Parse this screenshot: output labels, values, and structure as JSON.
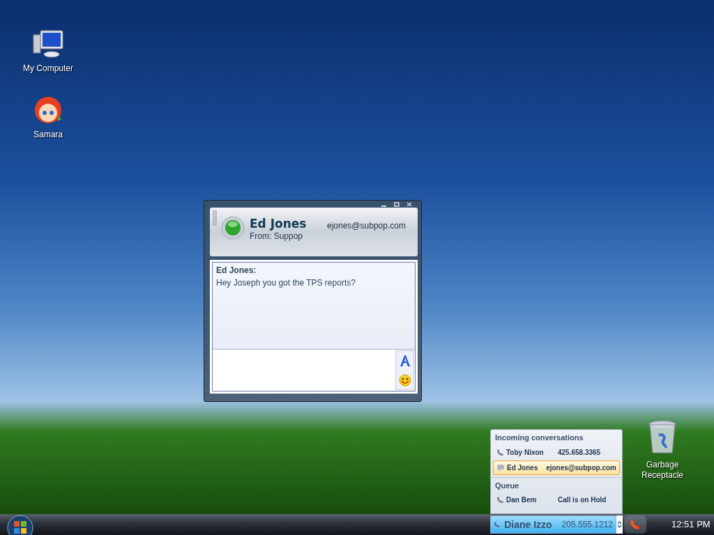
{
  "desktop_icons": [
    {
      "label": "My Computer",
      "kind": "computer"
    },
    {
      "label": "Samara",
      "kind": "avatar"
    },
    {
      "label": "Garbage Receptacle",
      "kind": "trash"
    }
  ],
  "chat_window": {
    "contact_name": "Ed Jones",
    "contact_email": "ejones@subpop.com",
    "from": "From: Suppop",
    "messages": [
      {
        "sender": "Ed Jones:",
        "text": "Hey Joseph you got the TPS reports?"
      }
    ]
  },
  "conversations_panel": {
    "sections": [
      {
        "title": "Incoming conversations",
        "items": [
          {
            "name": "Toby Nixon",
            "detail": "425.658.3365",
            "kind": "phone",
            "selected": false
          },
          {
            "name": "Ed Jones",
            "detail": "ejones@subpop.com",
            "kind": "chat",
            "selected": true
          }
        ]
      },
      {
        "title": "Queue",
        "items": [
          {
            "name": "Dan Bem",
            "detail": "Call is on Hold",
            "kind": "phone",
            "selected": false
          }
        ]
      }
    ]
  },
  "taskbar": {
    "active_call": {
      "name": "Diane Izzo",
      "number": "205.555.1212"
    },
    "clock": "12:51 PM"
  }
}
